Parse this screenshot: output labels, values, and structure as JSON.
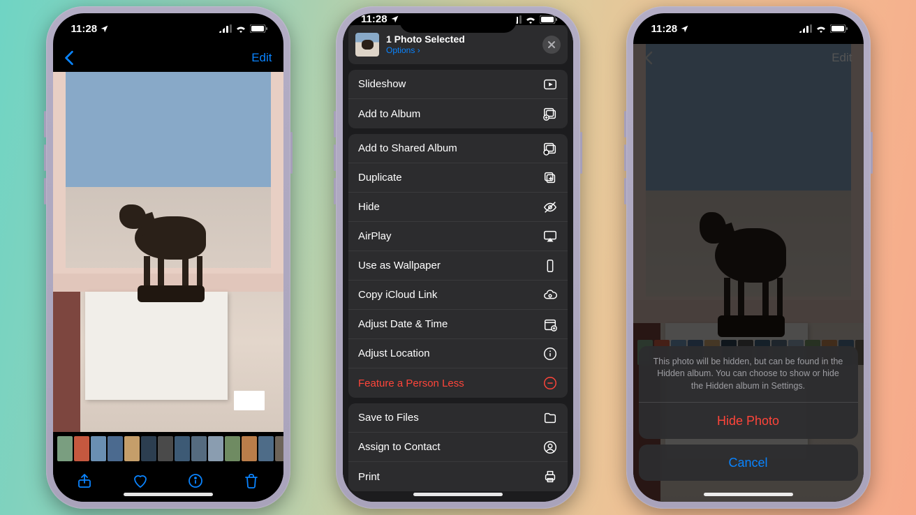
{
  "status": {
    "time": "11:28",
    "location_icon": "location-arrow"
  },
  "phone1": {
    "nav_edit": "Edit",
    "toolbar": {
      "share": "share-icon",
      "favorite": "heart-icon",
      "info": "info-icon",
      "delete": "trash-icon"
    },
    "thumbs": [
      "#7a9e80",
      "#c5583f",
      "#6a8fb2",
      "#4b6a8f",
      "#c59e6a",
      "#2c3e50",
      "#4a4a4a",
      "#3d5a75",
      "#556b7f",
      "#8a9db0",
      "#6f8b62",
      "#ba7d4a",
      "#4e6c88",
      "#6d6459"
    ]
  },
  "phone2": {
    "header_title": "1 Photo Selected",
    "options_label": "Options",
    "groups": [
      {
        "rows": [
          {
            "label": "Slideshow",
            "icon": "play-rect",
            "dest": false
          },
          {
            "label": "Add to Album",
            "icon": "album-plus",
            "dest": false
          }
        ]
      },
      {
        "rows": [
          {
            "label": "Add to Shared Album",
            "icon": "shared-album",
            "dest": false
          },
          {
            "label": "Duplicate",
            "icon": "duplicate",
            "dest": false
          },
          {
            "label": "Hide",
            "icon": "eye-slash",
            "dest": false
          },
          {
            "label": "AirPlay",
            "icon": "airplay",
            "dest": false
          },
          {
            "label": "Use as Wallpaper",
            "icon": "phone-rect",
            "dest": false
          },
          {
            "label": "Copy iCloud Link",
            "icon": "cloud-link",
            "dest": false
          },
          {
            "label": "Adjust Date & Time",
            "icon": "calendar-plus",
            "dest": false
          },
          {
            "label": "Adjust Location",
            "icon": "info-circle",
            "dest": false
          },
          {
            "label": "Feature a Person Less",
            "icon": "minus-circle",
            "dest": true
          }
        ]
      },
      {
        "rows": [
          {
            "label": "Save to Files",
            "icon": "folder",
            "dest": false
          },
          {
            "label": "Assign to Contact",
            "icon": "person-circle",
            "dest": false
          },
          {
            "label": "Print",
            "icon": "printer",
            "dest": false
          }
        ]
      }
    ]
  },
  "phone3": {
    "nav_edit": "Edit",
    "sheet_message": "This photo will be hidden, but can be found in the Hidden album. You can choose to show or hide the Hidden album in Settings.",
    "hide_label": "Hide Photo",
    "cancel_label": "Cancel"
  }
}
